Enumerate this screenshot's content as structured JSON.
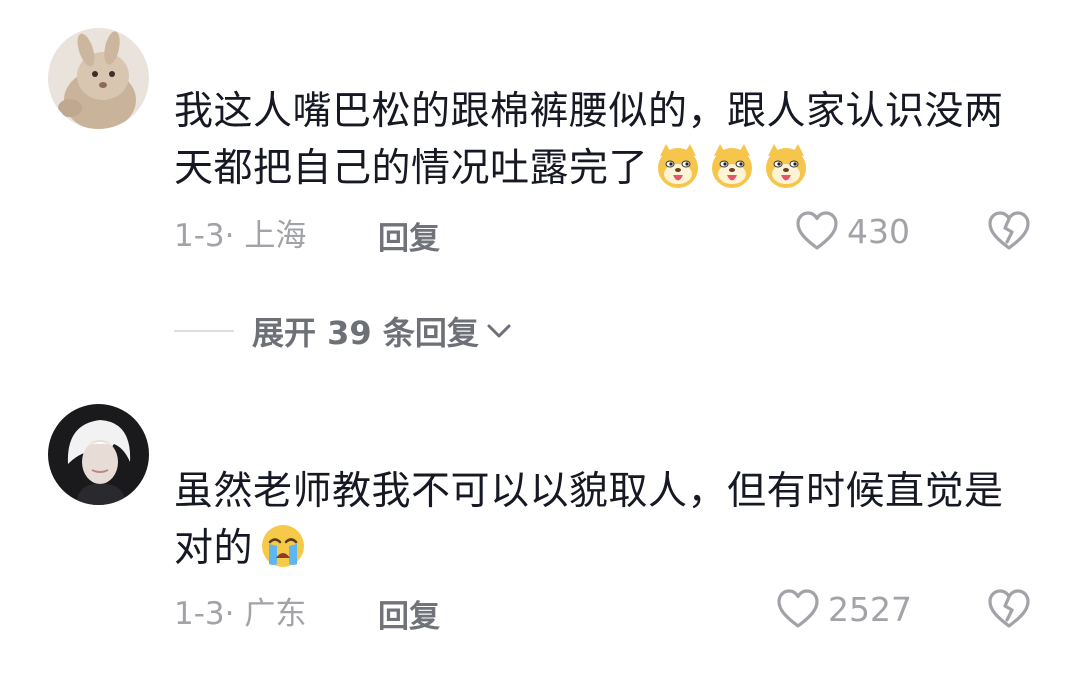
{
  "colors": {
    "text_primary": "#161823",
    "text_meta": "#a2a3a8",
    "text_action": "#6e7078",
    "background": "#ffffff"
  },
  "comments": [
    {
      "text": "我这人嘴巴松的跟棉裤腰似的，跟人家认识没两天都把自己的情况吐露完了",
      "emojis": [
        "smug-dog-emoji",
        "smug-dog-emoji",
        "smug-dog-emoji"
      ],
      "date_location": "1-3· 上海",
      "reply_label": "回复",
      "likes": "430",
      "avatar": "plush-rabbit-avatar"
    },
    {
      "text": "虽然老师教我不可以以貌取人，但有时候直觉是对的",
      "emojis": [
        "crying-face-emoji"
      ],
      "date_location": "1-3· 广东",
      "reply_label": "回复",
      "likes": "2527",
      "avatar": "white-hair-person-avatar"
    }
  ],
  "expand_replies": {
    "label": "展开 39 条回复"
  }
}
